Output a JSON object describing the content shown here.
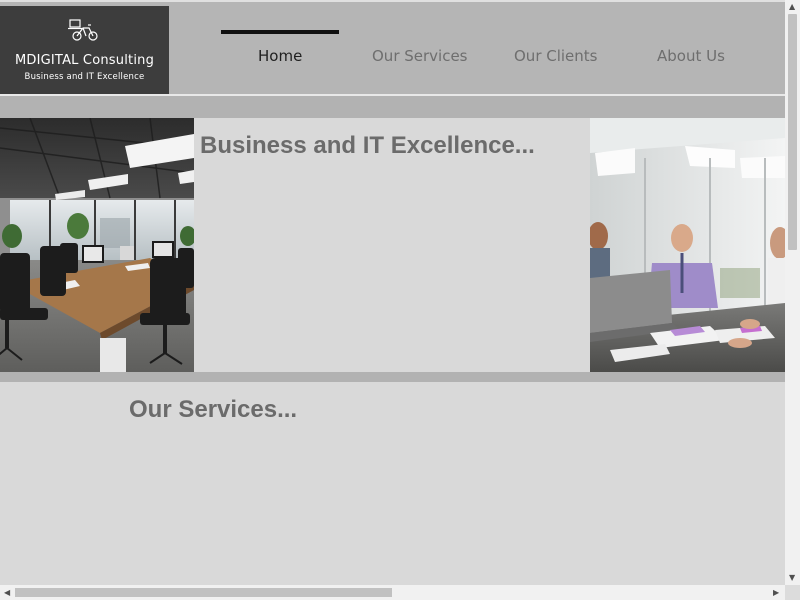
{
  "logo": {
    "title": "MDIGITAL Consulting",
    "subtitle": "Business and IT Excellence",
    "icon": "laptop-bike-icon"
  },
  "nav": {
    "items": [
      {
        "label": "Home",
        "active": true
      },
      {
        "label": "Our Services",
        "active": false
      },
      {
        "label": "Our Clients",
        "active": false
      },
      {
        "label": "About Us",
        "active": false
      }
    ]
  },
  "hero": {
    "heading": "Business and IT Excellence...",
    "left_image": "office-interior-image",
    "right_image": "business-meeting-image"
  },
  "services": {
    "heading": "Our Services..."
  },
  "colors": {
    "header_bg": "#b5b5b5",
    "logo_bg": "#3d3d3d",
    "page_bg": "#d9d9d9",
    "heading_text": "#6b6b6b",
    "nav_active": "#1f1f1f",
    "nav_inactive": "#6e6e6e"
  }
}
